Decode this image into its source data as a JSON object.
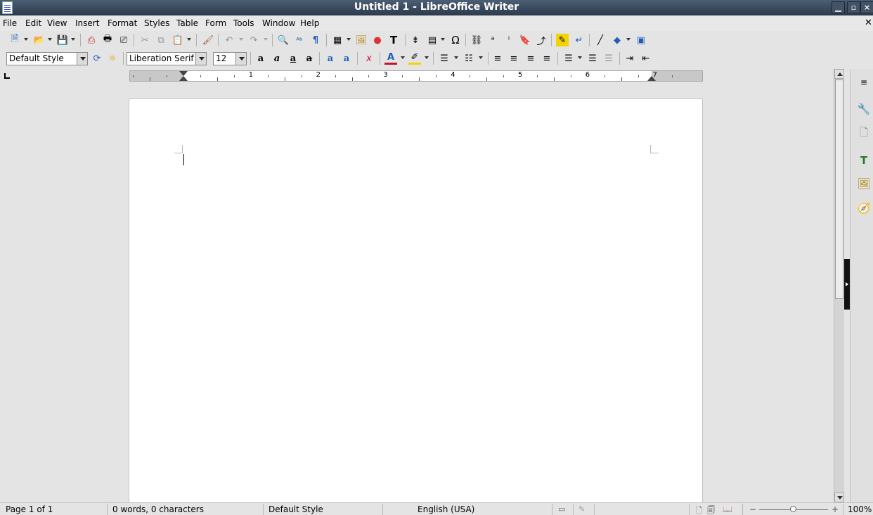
{
  "window": {
    "title": "Untitled 1 - LibreOffice Writer",
    "minimize": "▁",
    "maximize": "▫",
    "close": "×"
  },
  "menubar": {
    "items": [
      "File",
      "Edit",
      "View",
      "Insert",
      "Format",
      "Styles",
      "Table",
      "Form",
      "Tools",
      "Window",
      "Help"
    ],
    "close_doc": "✕"
  },
  "formatting": {
    "paragraph_style": "Default Style",
    "font_name": "Liberation Serif",
    "font_size": "12"
  },
  "ruler": {
    "unit": "inch",
    "labels": [
      "1",
      "2",
      "3",
      "4",
      "5",
      "6",
      "7"
    ]
  },
  "statusbar": {
    "page": "Page 1 of 1",
    "words": "0 words, 0 characters",
    "page_style": "Default Style",
    "language": "English (USA)",
    "zoom_minus": "−",
    "zoom_plus": "+",
    "zoom": "100%"
  },
  "icons": {
    "new": "🗎",
    "open": "📂",
    "save": "💾",
    "export_pdf": "⎙",
    "print": "🖶",
    "print_preview": "⎚",
    "cut": "✂",
    "copy": "⧉",
    "paste": "📋",
    "clone": "🖌",
    "undo": "↶",
    "redo": "↷",
    "find": "🔍",
    "spelling": "ᴬᵇ",
    "formatting_marks": "¶",
    "table": "▦",
    "image": "🖼",
    "chart": "●",
    "textbox": "T",
    "page_break": "⇟",
    "field": "▤",
    "special_char": "Ω",
    "hyperlink": "⛓",
    "footnote": "ᵃ",
    "endnote": "ⁱ",
    "bookmark": "🔖",
    "cross_ref": "⤴",
    "comment": "✎",
    "track": "↵",
    "line": "╱",
    "shapes": "◆",
    "draw": "▣",
    "update_style": "⟳",
    "new_style": "☼",
    "bold": "a",
    "italic": "a",
    "underline": "a",
    "strike": "a",
    "superscript": "a",
    "subscript": "a",
    "clear_format": "ⅹ",
    "font_color": "A",
    "highlight": "✐",
    "bullets": "☰",
    "numbering": "☷",
    "align_left": "≡",
    "align_center": "≡",
    "align_right": "≡",
    "justify": "≡",
    "line_spacing": "☰",
    "para_up": "☰",
    "para_down": "☰",
    "indent_inc": "⇥",
    "indent_dec": "⇤",
    "sidebar_menu": "≡",
    "sidebar_properties": "🔧",
    "sidebar_page": "🗋",
    "sidebar_styles": "T",
    "sidebar_gallery": "🖼",
    "sidebar_navigator": "🧭",
    "view_normal": "🗋",
    "view_multi": "🗐",
    "view_book": "📖",
    "selection_mode": "▭",
    "doc_modified": "✎"
  },
  "colors": {
    "titlebar_top": "#4c5e74",
    "titlebar_bottom": "#2c3a4c",
    "chrome": "#e4e4e4",
    "page": "#ffffff",
    "accent_blue": "#1f5fb8",
    "font_color_red": "#c0182a",
    "highlight_yellow": "#f4d400"
  }
}
